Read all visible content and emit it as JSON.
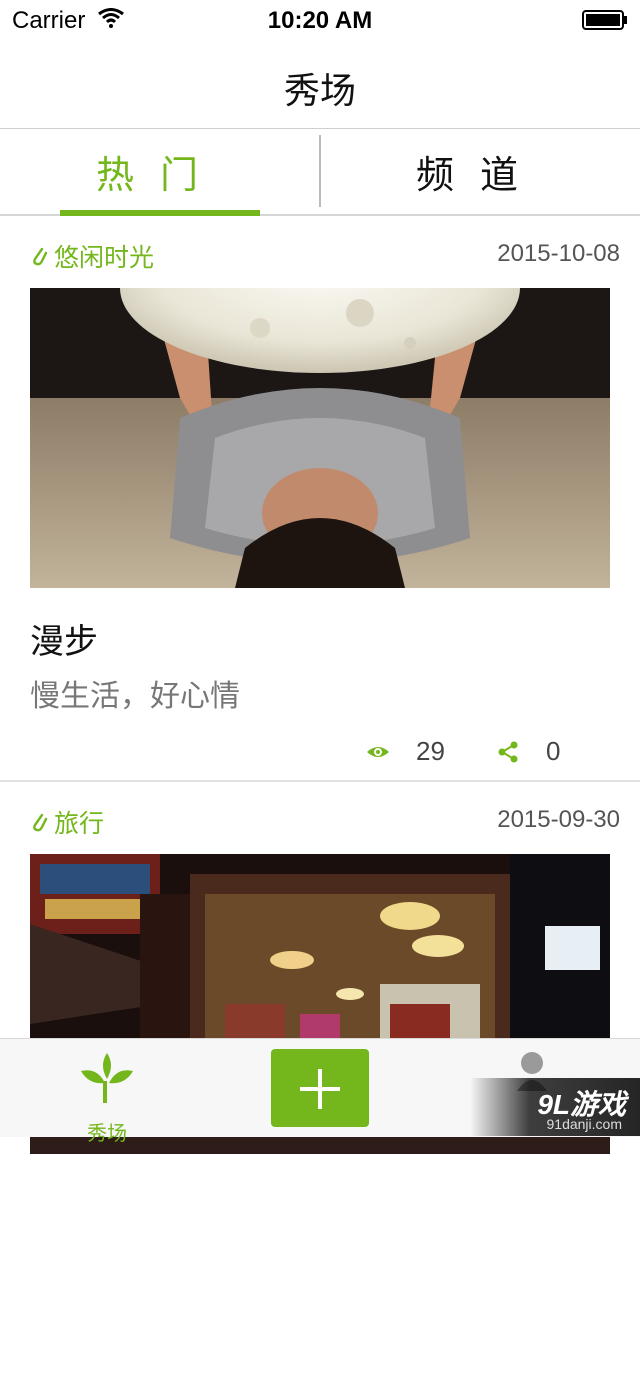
{
  "status_bar": {
    "carrier": "Carrier",
    "time": "10:20 AM"
  },
  "nav": {
    "title": "秀场"
  },
  "tabs": [
    {
      "label": "热门",
      "active": true
    },
    {
      "label": "频道",
      "active": false
    }
  ],
  "feed": [
    {
      "tag": "悠闲时光",
      "date": "2015-10-08",
      "image": "girl-holding-moon-lamp",
      "title": "漫步",
      "subtitle": "慢生活，好心情",
      "views": "29",
      "shares": "0"
    },
    {
      "tag": "旅行",
      "date": "2015-09-30",
      "image": "night-street-shopfront-lanterns"
    }
  ],
  "bottom_bar": {
    "home_label": "秀场",
    "add_icon": "plus-icon",
    "profile_icon": "person-icon"
  },
  "watermark": {
    "main": "9L游戏",
    "sub": "91danji.com"
  },
  "colors": {
    "accent": "#74b71c",
    "text": "#222222",
    "muted": "#777777"
  }
}
